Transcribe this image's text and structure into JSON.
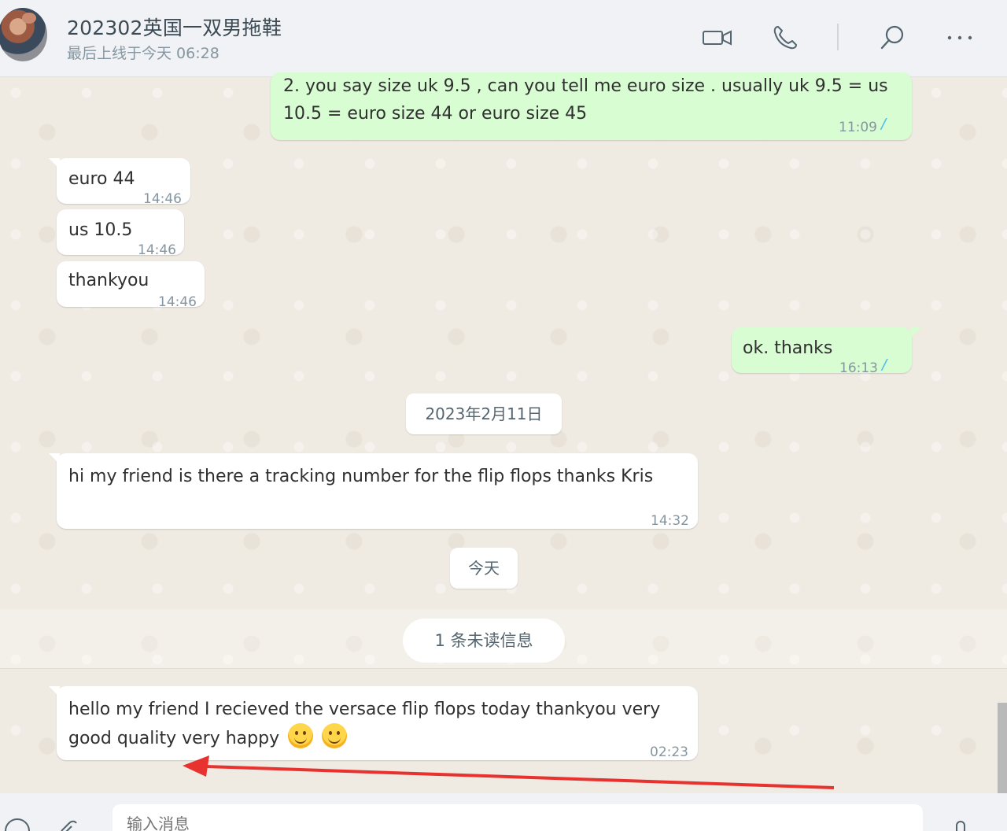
{
  "header": {
    "contact_name": "202302英国一双男拖鞋",
    "last_seen": "最后上线于今天 06:28",
    "icons": [
      "video-call-icon",
      "voice-call-icon",
      "search-icon",
      "more-options-icon"
    ]
  },
  "messages": [
    {
      "direction": "out",
      "text_line1": "2. you say size uk 9.5 , can you tell me euro size . usually uk 9.5  = us",
      "text_line2": "10.5 = euro size 44 or euro size 45",
      "time": "11:09",
      "status": "read"
    },
    {
      "direction": "in",
      "text": "euro 44",
      "time": "14:46"
    },
    {
      "direction": "in",
      "text": "us 10.5",
      "time": "14:46"
    },
    {
      "direction": "in",
      "text": "thankyou",
      "time": "14:46"
    },
    {
      "direction": "out",
      "text": "ok. thanks",
      "time": "16:13",
      "status": "read"
    },
    {
      "direction": "in",
      "text": "hi my friend is there a tracking number for the flip flops thanks Kris",
      "time": "14:32"
    },
    {
      "direction": "in",
      "text_line1": "hello my friend I recieved the versace flip flops today thankyou very",
      "text_line2": "good  quality very happy",
      "time": "02:23",
      "emojis": [
        "smiling-face-emoji",
        "smiling-face-emoji"
      ]
    }
  ],
  "dividers": {
    "date1": "2023年2月11日",
    "date2": "今天",
    "unread": "1 条未读信息"
  },
  "composer": {
    "placeholder": "输入消息"
  },
  "colors": {
    "outgoing_bubble": "#d9fdd3",
    "incoming_bubble": "#ffffff",
    "read_ticks": "#53bdeb",
    "annotation_arrow": "#e8322f"
  }
}
